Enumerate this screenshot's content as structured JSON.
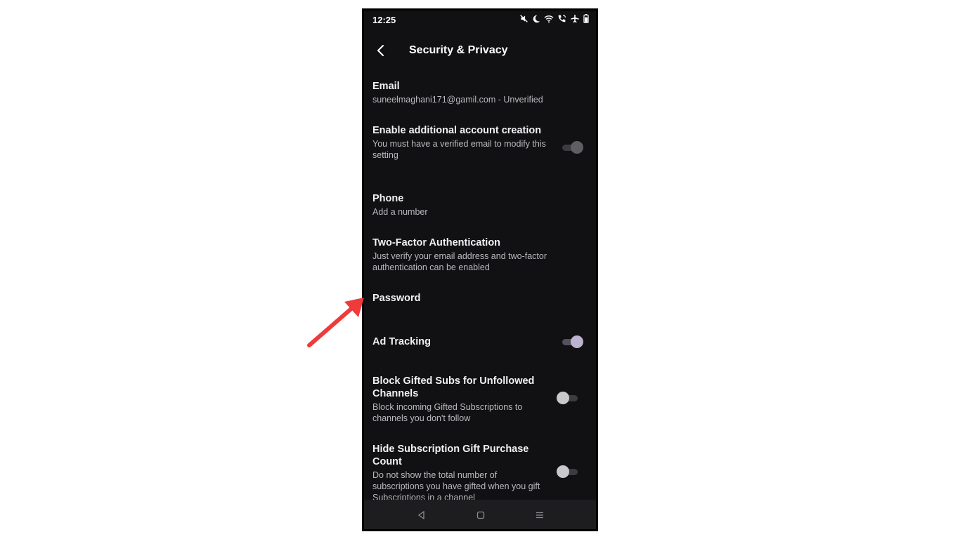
{
  "status_bar": {
    "time": "12:25",
    "icons": [
      "mute-icon",
      "moon-icon",
      "wifi-icon",
      "wifi-calling-icon",
      "airplane-icon",
      "battery-icon"
    ]
  },
  "header": {
    "back_icon": "back-chevron-icon",
    "title": "Security & Privacy"
  },
  "settings": {
    "email": {
      "title": "Email",
      "subtitle": "suneelmaghani171@gamil.com - Unverified"
    },
    "account_creation": {
      "title": "Enable additional account creation",
      "subtitle": "You must have a verified email to modify this setting",
      "toggle": "disabled-off"
    },
    "phone": {
      "title": "Phone",
      "subtitle": "Add a number"
    },
    "two_factor": {
      "title": "Two-Factor Authentication",
      "subtitle": "Just verify your email address and two-factor authentication can be enabled"
    },
    "password": {
      "title": "Password"
    },
    "ad_tracking": {
      "title": "Ad Tracking",
      "toggle": "on"
    },
    "block_gifted": {
      "title": "Block Gifted Subs for Unfollowed Channels",
      "subtitle": "Block incoming Gifted Subscriptions to channels you don't follow",
      "toggle": "off"
    },
    "hide_gift_count": {
      "title": "Hide Subscription Gift Purchase Count",
      "subtitle": "Do not show the total number of subscriptions you have gifted when you gift Subscriptions in a channel",
      "toggle": "off"
    }
  },
  "nav_bar": {
    "buttons": [
      "back-triangle-icon",
      "home-square-icon",
      "recents-menu-icon"
    ]
  },
  "annotation": {
    "arrow_color": "#ee3b3b"
  },
  "colors": {
    "background": "#111113",
    "toggle_on": "#bdb2d0"
  }
}
